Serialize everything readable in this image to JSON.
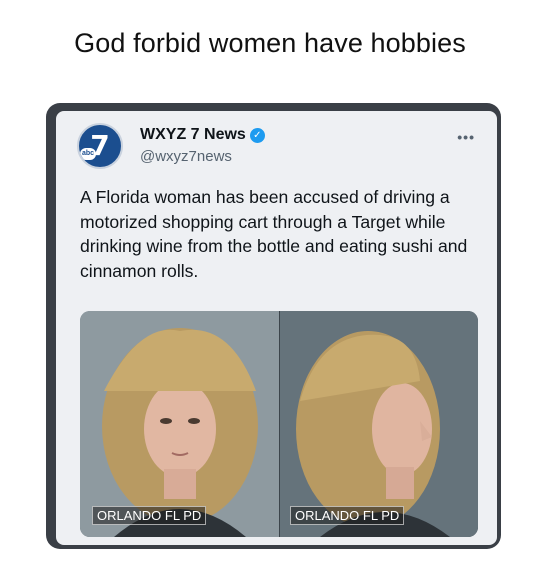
{
  "caption": "God forbid women have hobbies",
  "tweet": {
    "display_name": "WXYZ 7 News",
    "handle": "@wxyz7news",
    "text": "A Florida woman has been accused of driving a motorized shopping cart through a Target while drinking wine from the bottle and eating sushi and cinnamon rolls.",
    "verified_icon": "check",
    "more_icon": "•••",
    "avatar": {
      "logo_number": "7",
      "logo_badge": "abc",
      "color": "#1b4e8f"
    },
    "media": {
      "left_watermark": "ORLANDO FL PD",
      "right_watermark": "ORLANDO FL PD"
    }
  }
}
